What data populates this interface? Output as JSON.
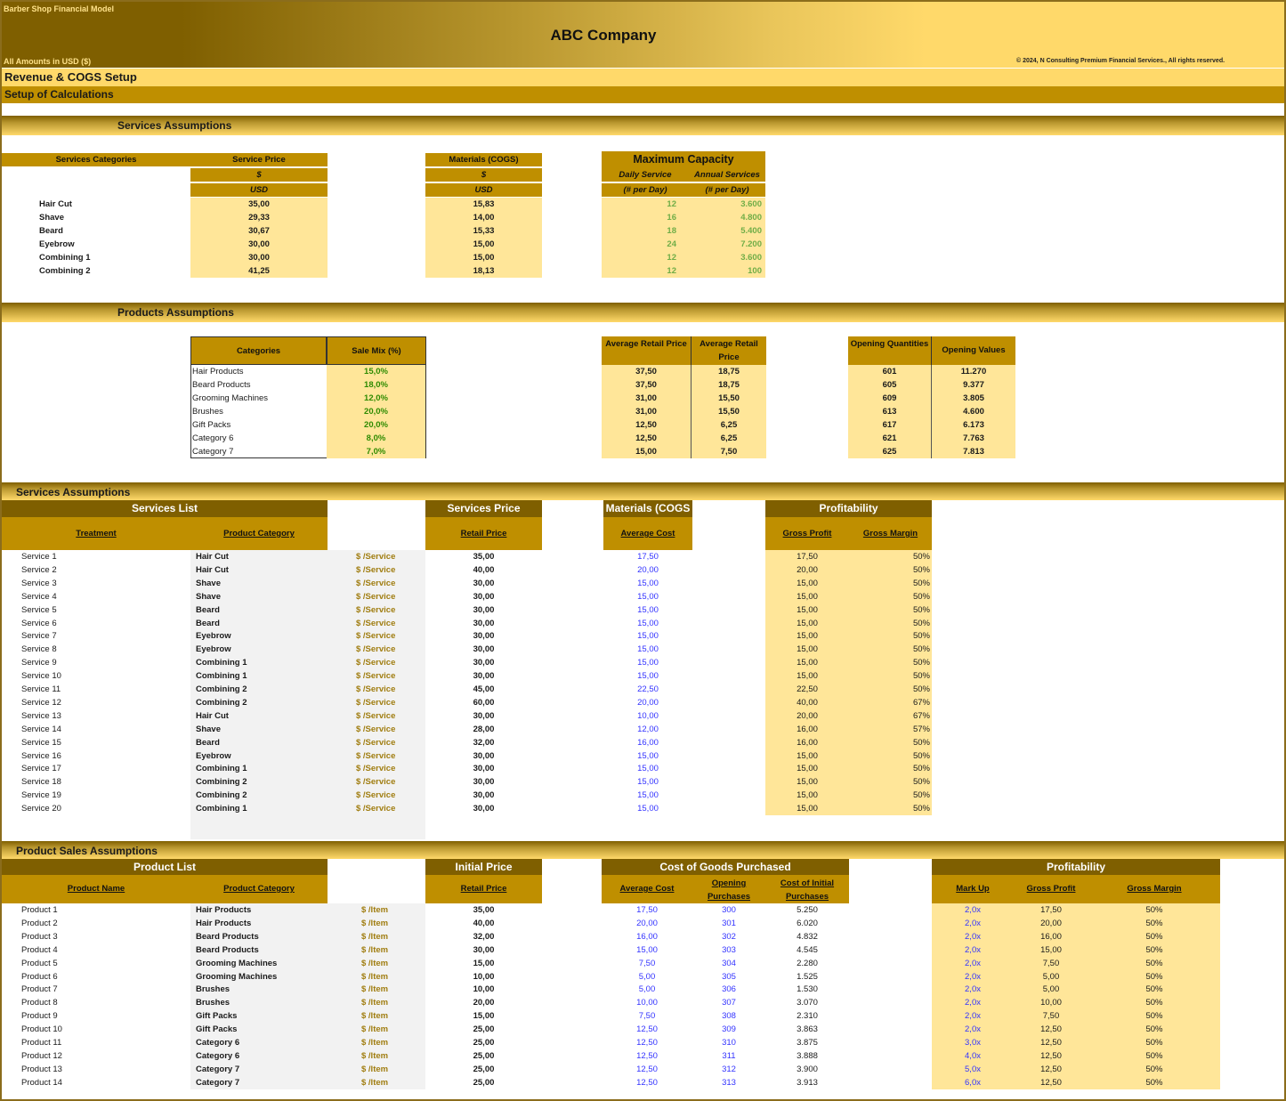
{
  "header": {
    "model_name": "Barber Shop Financial Model",
    "company": "ABC Company",
    "amounts_note": "All Amounts in  USD ($)",
    "copyright": "© 2024, N Consulting Premium Financial Services., All rights reserved.",
    "page_title": "Revenue & COGS Setup",
    "subtitle": "Setup of Calculations"
  },
  "colors": {
    "dark_gold": "#7f5f00",
    "gold": "#bf8f00",
    "light_yellow": "#ffe699",
    "banner_yellow": "#ffd96a",
    "input_blue": "#3333ff",
    "green": "#70ad47"
  },
  "services_assumptions": {
    "title": "Services Assumptions",
    "col_categories": "Services Categories",
    "col_price": "Service Price",
    "col_cogs": "Materials (COGS)",
    "currency_symbol": "$",
    "currency": "USD",
    "capacity_title": "Maximum Capacity",
    "col_daily": "Daily Service",
    "col_annual": "Annual Services",
    "unit_daily": "(# per Day)",
    "unit_annual": "(# per Day)",
    "rows": [
      {
        "category": "Hair Cut",
        "price": "35,00",
        "cogs": "15,83",
        "daily": "12",
        "annual": "3.600"
      },
      {
        "category": "Shave",
        "price": "29,33",
        "cogs": "14,00",
        "daily": "16",
        "annual": "4.800"
      },
      {
        "category": "Beard",
        "price": "30,67",
        "cogs": "15,33",
        "daily": "18",
        "annual": "5.400"
      },
      {
        "category": "Eyebrow",
        "price": "30,00",
        "cogs": "15,00",
        "daily": "24",
        "annual": "7.200"
      },
      {
        "category": "Combining 1",
        "price": "30,00",
        "cogs": "15,00",
        "daily": "12",
        "annual": "3.600"
      },
      {
        "category": "Combining 2",
        "price": "41,25",
        "cogs": "18,13",
        "daily": "12",
        "annual": "100"
      }
    ]
  },
  "products_assumptions": {
    "title": "Products Assumptions",
    "col_categories": "Categories",
    "col_sale_mix": "Sale Mix (%)",
    "col_avg_retail_1": "Average Retail Price",
    "col_avg_retail_2": "Average Retail Price",
    "col_opening_qty": "Opening Quantities",
    "col_opening_val": "Opening Values",
    "rows": [
      {
        "category": "Hair Products",
        "mix": "15,0%",
        "retail1": "37,50",
        "retail2": "18,75",
        "qty": "601",
        "value": "11.270"
      },
      {
        "category": "Beard Products",
        "mix": "18,0%",
        "retail1": "37,50",
        "retail2": "18,75",
        "qty": "605",
        "value": "9.377"
      },
      {
        "category": "Grooming Machines",
        "mix": "12,0%",
        "retail1": "31,00",
        "retail2": "15,50",
        "qty": "609",
        "value": "3.805"
      },
      {
        "category": "Brushes",
        "mix": "20,0%",
        "retail1": "31,00",
        "retail2": "15,50",
        "qty": "613",
        "value": "4.600"
      },
      {
        "category": "Gift Packs",
        "mix": "20,0%",
        "retail1": "12,50",
        "retail2": "6,25",
        "qty": "617",
        "value": "6.173"
      },
      {
        "category": "Category 6",
        "mix": "8,0%",
        "retail1": "12,50",
        "retail2": "6,25",
        "qty": "621",
        "value": "7.763"
      },
      {
        "category": "Category 7",
        "mix": "7,0%",
        "retail1": "15,00",
        "retail2": "7,50",
        "qty": "625",
        "value": "7.813"
      }
    ]
  },
  "services_list": {
    "title": "Services Assumptions",
    "group_list": "Services List",
    "group_price": "Services Price",
    "group_cogs": "Materials (COGS",
    "group_profit": "Profitability",
    "col_treatment": "Treatment",
    "col_category": "Product Category",
    "col_retail": "Retail Price",
    "col_avg_cost": "Average Cost",
    "col_gross_profit": "Gross Profit",
    "col_gross_margin": "Gross Margin",
    "unit": "$ /Service",
    "rows": [
      {
        "name": "Service 1",
        "category": "Hair Cut",
        "price": "35,00",
        "cost": "17,50",
        "profit": "17,50",
        "margin": "50%"
      },
      {
        "name": "Service 2",
        "category": "Hair Cut",
        "price": "40,00",
        "cost": "20,00",
        "profit": "20,00",
        "margin": "50%"
      },
      {
        "name": "Service 3",
        "category": "Shave",
        "price": "30,00",
        "cost": "15,00",
        "profit": "15,00",
        "margin": "50%"
      },
      {
        "name": "Service 4",
        "category": "Shave",
        "price": "30,00",
        "cost": "15,00",
        "profit": "15,00",
        "margin": "50%"
      },
      {
        "name": "Service 5",
        "category": "Beard",
        "price": "30,00",
        "cost": "15,00",
        "profit": "15,00",
        "margin": "50%"
      },
      {
        "name": "Service 6",
        "category": "Beard",
        "price": "30,00",
        "cost": "15,00",
        "profit": "15,00",
        "margin": "50%"
      },
      {
        "name": "Service 7",
        "category": "Eyebrow",
        "price": "30,00",
        "cost": "15,00",
        "profit": "15,00",
        "margin": "50%"
      },
      {
        "name": "Service 8",
        "category": "Eyebrow",
        "price": "30,00",
        "cost": "15,00",
        "profit": "15,00",
        "margin": "50%"
      },
      {
        "name": "Service 9",
        "category": "Combining 1",
        "price": "30,00",
        "cost": "15,00",
        "profit": "15,00",
        "margin": "50%"
      },
      {
        "name": "Service 10",
        "category": "Combining 1",
        "price": "30,00",
        "cost": "15,00",
        "profit": "15,00",
        "margin": "50%"
      },
      {
        "name": "Service 11",
        "category": "Combining 2",
        "price": "45,00",
        "cost": "22,50",
        "profit": "22,50",
        "margin": "50%"
      },
      {
        "name": "Service 12",
        "category": "Combining 2",
        "price": "60,00",
        "cost": "20,00",
        "profit": "40,00",
        "margin": "67%"
      },
      {
        "name": "Service 13",
        "category": "Hair Cut",
        "price": "30,00",
        "cost": "10,00",
        "profit": "20,00",
        "margin": "67%"
      },
      {
        "name": "Service 14",
        "category": "Shave",
        "price": "28,00",
        "cost": "12,00",
        "profit": "16,00",
        "margin": "57%"
      },
      {
        "name": "Service 15",
        "category": "Beard",
        "price": "32,00",
        "cost": "16,00",
        "profit": "16,00",
        "margin": "50%"
      },
      {
        "name": "Service 16",
        "category": "Eyebrow",
        "price": "30,00",
        "cost": "15,00",
        "profit": "15,00",
        "margin": "50%"
      },
      {
        "name": "Service 17",
        "category": "Combining 1",
        "price": "30,00",
        "cost": "15,00",
        "profit": "15,00",
        "margin": "50%"
      },
      {
        "name": "Service 18",
        "category": "Combining 2",
        "price": "30,00",
        "cost": "15,00",
        "profit": "15,00",
        "margin": "50%"
      },
      {
        "name": "Service 19",
        "category": "Combining 2",
        "price": "30,00",
        "cost": "15,00",
        "profit": "15,00",
        "margin": "50%"
      },
      {
        "name": "Service 20",
        "category": "Combining 1",
        "price": "30,00",
        "cost": "15,00",
        "profit": "15,00",
        "margin": "50%"
      }
    ]
  },
  "product_sales": {
    "title": "Product Sales Assumptions",
    "group_list": "Product List",
    "group_price": "Initial Price",
    "group_cogs": "Cost of Goods Purchased",
    "group_profit": "Profitability",
    "col_name": "Product Name",
    "col_category": "Product Category",
    "col_retail": "Retail Price",
    "col_avg_cost": "Average Cost",
    "col_opening_purchases": "Opening Purchases",
    "col_cost_initial": "Cost of Initial Purchases",
    "col_markup": "Mark Up",
    "col_gross_profit": "Gross Profit",
    "col_gross_margin": "Gross Margin",
    "unit": "$ /Item",
    "rows": [
      {
        "name": "Product 1",
        "category": "Hair Products",
        "price": "35,00",
        "cost": "17,50",
        "opening": "300",
        "initial_cost": "5.250",
        "markup": "2,0x",
        "profit": "17,50",
        "margin": "50%"
      },
      {
        "name": "Product 2",
        "category": "Hair Products",
        "price": "40,00",
        "cost": "20,00",
        "opening": "301",
        "initial_cost": "6.020",
        "markup": "2,0x",
        "profit": "20,00",
        "margin": "50%"
      },
      {
        "name": "Product 3",
        "category": "Beard Products",
        "price": "32,00",
        "cost": "16,00",
        "opening": "302",
        "initial_cost": "4.832",
        "markup": "2,0x",
        "profit": "16,00",
        "margin": "50%"
      },
      {
        "name": "Product 4",
        "category": "Beard Products",
        "price": "30,00",
        "cost": "15,00",
        "opening": "303",
        "initial_cost": "4.545",
        "markup": "2,0x",
        "profit": "15,00",
        "margin": "50%"
      },
      {
        "name": "Product 5",
        "category": "Grooming Machines",
        "price": "15,00",
        "cost": "7,50",
        "opening": "304",
        "initial_cost": "2.280",
        "markup": "2,0x",
        "profit": "7,50",
        "margin": "50%"
      },
      {
        "name": "Product 6",
        "category": "Grooming Machines",
        "price": "10,00",
        "cost": "5,00",
        "opening": "305",
        "initial_cost": "1.525",
        "markup": "2,0x",
        "profit": "5,00",
        "margin": "50%"
      },
      {
        "name": "Product 7",
        "category": "Brushes",
        "price": "10,00",
        "cost": "5,00",
        "opening": "306",
        "initial_cost": "1.530",
        "markup": "2,0x",
        "profit": "5,00",
        "margin": "50%"
      },
      {
        "name": "Product 8",
        "category": "Brushes",
        "price": "20,00",
        "cost": "10,00",
        "opening": "307",
        "initial_cost": "3.070",
        "markup": "2,0x",
        "profit": "10,00",
        "margin": "50%"
      },
      {
        "name": "Product 9",
        "category": "Gift Packs",
        "price": "15,00",
        "cost": "7,50",
        "opening": "308",
        "initial_cost": "2.310",
        "markup": "2,0x",
        "profit": "7,50",
        "margin": "50%"
      },
      {
        "name": "Product 10",
        "category": "Gift Packs",
        "price": "25,00",
        "cost": "12,50",
        "opening": "309",
        "initial_cost": "3.863",
        "markup": "2,0x",
        "profit": "12,50",
        "margin": "50%"
      },
      {
        "name": "Product 11",
        "category": "Category 6",
        "price": "25,00",
        "cost": "12,50",
        "opening": "310",
        "initial_cost": "3.875",
        "markup": "3,0x",
        "profit": "12,50",
        "margin": "50%"
      },
      {
        "name": "Product 12",
        "category": "Category 6",
        "price": "25,00",
        "cost": "12,50",
        "opening": "311",
        "initial_cost": "3.888",
        "markup": "4,0x",
        "profit": "12,50",
        "margin": "50%"
      },
      {
        "name": "Product 13",
        "category": "Category 7",
        "price": "25,00",
        "cost": "12,50",
        "opening": "312",
        "initial_cost": "3.900",
        "markup": "5,0x",
        "profit": "12,50",
        "margin": "50%"
      },
      {
        "name": "Product 14",
        "category": "Category 7",
        "price": "25,00",
        "cost": "12,50",
        "opening": "313",
        "initial_cost": "3.913",
        "markup": "6,0x",
        "profit": "12,50",
        "margin": "50%"
      }
    ]
  }
}
